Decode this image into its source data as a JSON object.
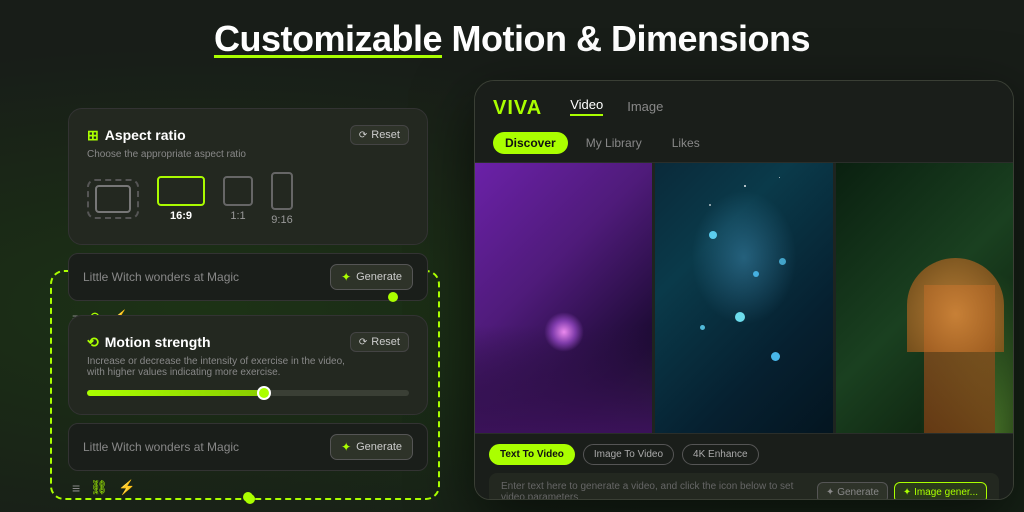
{
  "page": {
    "title_part1": "Customizable",
    "title_part2": " Motion & Dimensions"
  },
  "aspect_card": {
    "icon": "⟳",
    "title": "Aspect ratio",
    "subtitle": "Choose the appropriate aspect ratio",
    "reset_label": "Reset",
    "options": [
      {
        "label": "16:9",
        "active": true
      },
      {
        "label": "1:1",
        "active": false
      },
      {
        "label": "9:16",
        "active": false
      }
    ]
  },
  "motion_card": {
    "icon": "⟲",
    "title": "Motion strength",
    "subtitle": "Increase or decrease the intensity of exercise in the video,\nwith higher values indicating more exercise.",
    "reset_label": "Reset",
    "slider_value": 55
  },
  "prompt": {
    "placeholder": "Little Witch wonders at Magic",
    "generate_label": "Generate"
  },
  "app": {
    "logo": "VIVA",
    "tabs": [
      {
        "label": "Video",
        "active": true
      },
      {
        "label": "Image",
        "active": false
      }
    ],
    "subtabs": [
      {
        "label": "Discover",
        "active": true
      },
      {
        "label": "My Library",
        "active": false
      },
      {
        "label": "Likes",
        "active": false
      }
    ],
    "bottom_tabs": [
      {
        "label": "Text To Video",
        "active": true
      },
      {
        "label": "Image To Video",
        "active": false
      },
      {
        "label": "4K Enhance",
        "active": false
      }
    ],
    "input_placeholder": "Enter text here to generate a video, and click the icon below to set video parameters",
    "generate_label": "✦ Generate",
    "generate_label2": "✦ Image gener..."
  }
}
